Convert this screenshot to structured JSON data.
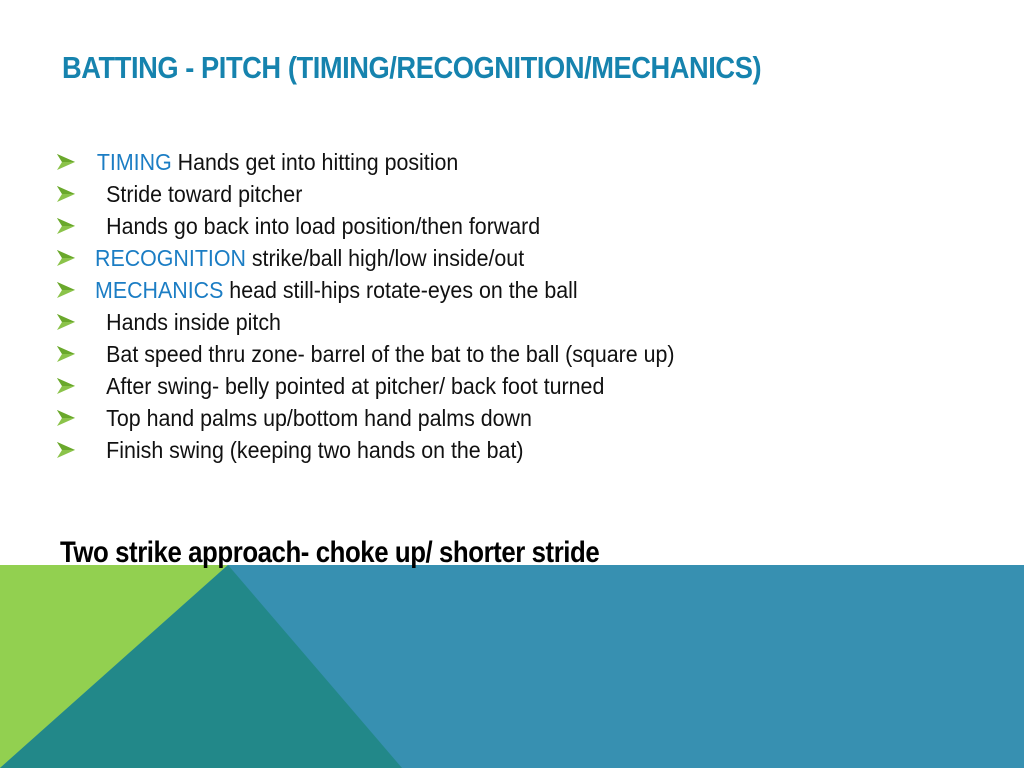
{
  "slide": {
    "title": "BATTING - PITCH (TIMING/RECOGNITION/MECHANICS)",
    "bullets": [
      {
        "keyword": "TIMING",
        "text": " Hands get into hitting position"
      },
      {
        "keyword": "",
        "text": "Stride toward pitcher"
      },
      {
        "keyword": "",
        "text": "Hands go back into load position/then forward"
      },
      {
        "keyword": "RECOGNITION",
        "text": " strike/ball high/low inside/out"
      },
      {
        "keyword": "MECHANICS",
        "text": " head still-hips rotate-eyes on the ball"
      },
      {
        "keyword": "",
        "text": "Hands inside pitch"
      },
      {
        "keyword": "",
        "text": "Bat speed thru zone- barrel of the bat to the ball (square up)"
      },
      {
        "keyword": "",
        "text": "After swing- belly pointed at pitcher/ back foot turned"
      },
      {
        "keyword": "",
        "text": "Top hand palms up/bottom hand palms down"
      },
      {
        "keyword": "",
        "text": "Finish swing (keeping two hands on the bat)"
      }
    ],
    "footer_note": "Two strike approach- choke up/ shorter stride",
    "colors": {
      "title": "#1683ae",
      "keyword": "#1b7dc4",
      "bullet_arrow": "#8bc34a",
      "band_green": "#92d050",
      "band_teal": "#228889",
      "band_blue": "#3790b1"
    }
  }
}
